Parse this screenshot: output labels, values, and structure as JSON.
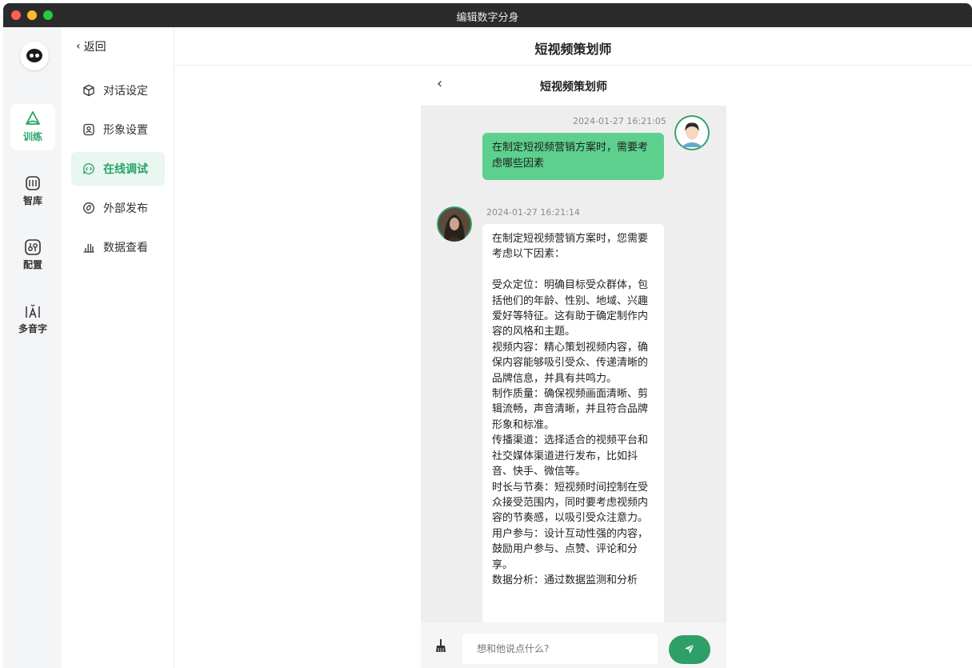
{
  "window": {
    "title": "编辑数字分身"
  },
  "rail": {
    "items": [
      {
        "id": "train",
        "label": "训练",
        "active": true
      },
      {
        "id": "library",
        "label": "智库",
        "active": false
      },
      {
        "id": "config",
        "label": "配置",
        "active": false
      },
      {
        "id": "polyphone",
        "label": "多音字",
        "active": false
      }
    ]
  },
  "subnav": {
    "back_label": "返回",
    "items": [
      {
        "label": "对话设定",
        "icon": "cube-icon",
        "active": false
      },
      {
        "label": "形象设置",
        "icon": "portrait-icon",
        "active": false
      },
      {
        "label": "在线调试",
        "icon": "code-chat-icon",
        "active": true
      },
      {
        "label": "外部发布",
        "icon": "publish-icon",
        "active": false
      },
      {
        "label": "数据查看",
        "icon": "bar-chart-icon",
        "active": false
      }
    ]
  },
  "header": {
    "title": "短视频策划师"
  },
  "phone": {
    "title": "短视频策划师",
    "messages": [
      {
        "role": "user",
        "timestamp": "2024-01-27 16:21:05",
        "text": "在制定短视频营销方案时，需要考虑哪些因素"
      },
      {
        "role": "bot",
        "timestamp": "2024-01-27 16:21:14",
        "text": "在制定短视频营销方案时，您需要考虑以下因素：\n\n受众定位：明确目标受众群体，包括他们的年龄、性别、地域、兴趣爱好等特征。这有助于确定制作内容的风格和主题。\n视频内容：精心策划视频内容，确保内容能够吸引受众、传递清晰的品牌信息，并具有共鸣力。\n制作质量：确保视频画面清晰、剪辑流畅，声音清晰，并且符合品牌形象和标准。\n传播渠道：选择适合的视频平台和社交媒体渠道进行发布，比如抖音、快手、微信等。\n时长与节奏：短视频时间控制在受众接受范围内，同时要考虑视频内容的节奏感，以吸引受众注意力。\n用户参与：设计互动性强的内容，鼓励用户参与、点赞、评论和分享。\n数据分析：通过数据监测和分析"
      }
    ],
    "input": {
      "placeholder": "想和他说点什么?",
      "value": ""
    }
  },
  "colors": {
    "accent": "#27a46a",
    "user_bubble": "#5ed08e",
    "send_button": "#2e9f67"
  }
}
